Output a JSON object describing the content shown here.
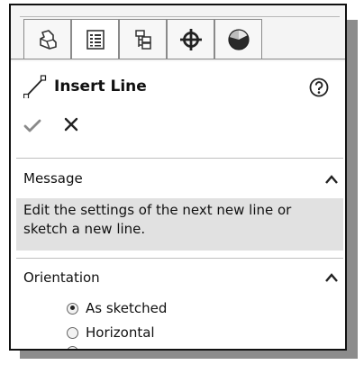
{
  "panel": {
    "tabs": [
      {
        "icon": "feature-manager-icon",
        "active": false
      },
      {
        "icon": "property-manager-icon",
        "active": true
      },
      {
        "icon": "configuration-manager-icon",
        "active": false
      },
      {
        "icon": "dimxpert-manager-icon",
        "active": false
      },
      {
        "icon": "display-manager-icon",
        "active": false
      }
    ],
    "title": "Insert Line",
    "title_icon": "line-icon",
    "help_icon": "help-icon",
    "ok_icon": "checkmark-icon",
    "cancel_icon": "close-icon"
  },
  "message": {
    "title": "Message",
    "text_line1": "Edit the settings of the next new line or",
    "text_line2": "sketch a new line."
  },
  "orientation": {
    "title": "Orientation",
    "options": [
      {
        "label": "As sketched",
        "checked": true
      },
      {
        "label": "Horizontal",
        "checked": false
      }
    ]
  },
  "colors": {
    "shadow": "#8c8c8c",
    "message_bg": "#e1e1e1",
    "border": "#111111"
  }
}
